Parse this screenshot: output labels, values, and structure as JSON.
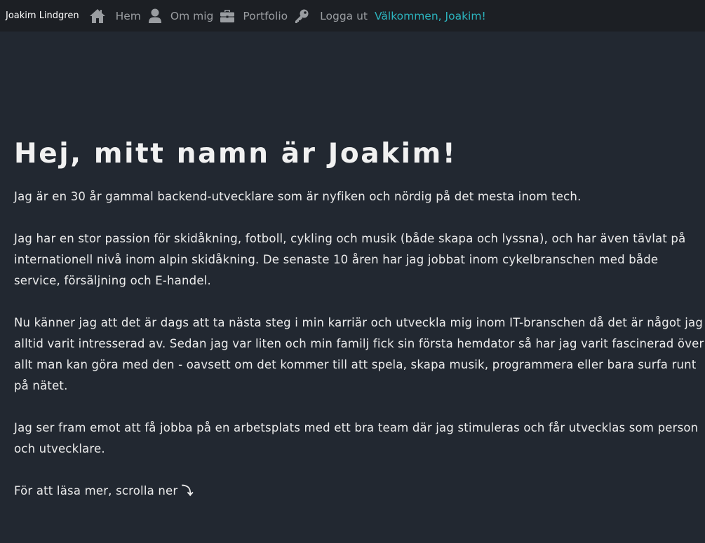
{
  "nav": {
    "brand": "Joakim Lindgren",
    "items": [
      {
        "label": "Hem",
        "icon": "home-icon"
      },
      {
        "label": "Om mig",
        "icon": "user-icon"
      },
      {
        "label": "Portfolio",
        "icon": "briefcase-icon"
      },
      {
        "label": "Logga ut",
        "icon": "key-icon"
      }
    ],
    "welcome": "Välkommen, Joakim!"
  },
  "main": {
    "headline": "Hej, mitt namn är Joakim!",
    "paragraphs": [
      "Jag är en 30 år gammal backend-utvecklare som är nyfiken och nördig på det mesta inom tech.",
      "Jag har en stor passion för skidåkning, fotboll, cykling och musik (både skapa och lyssna), och har även tävlat på internationell nivå inom alpin skidåkning. De senaste 10 åren har jag jobbat inom cykelbranschen med både service, försäljning och E-handel.",
      "Nu känner jag att det är dags att ta nästa steg i min karriär och utveckla mig inom IT-branschen då det är något jag alltid varit intresserad av. Sedan jag var liten och min familj fick sin första hemdator så har jag varit fascinerad över allt man kan göra med den - oavsett om det kommer till att spela, skapa musik, programmera eller bara surfa runt på nätet.",
      "Jag ser fram emot att få jobba på en arbetsplats med ett bra team där jag stimuleras och får utvecklas som person och utvecklare."
    ],
    "scroll_hint": "För att läsa mer, scrolla ner",
    "scroll_hint_arrow": "⤵"
  },
  "colors": {
    "background": "#222831",
    "navbar": "#1c1f24",
    "nav_link": "#9a9da1",
    "accent": "#2cb3bd",
    "text": "#ececec"
  }
}
